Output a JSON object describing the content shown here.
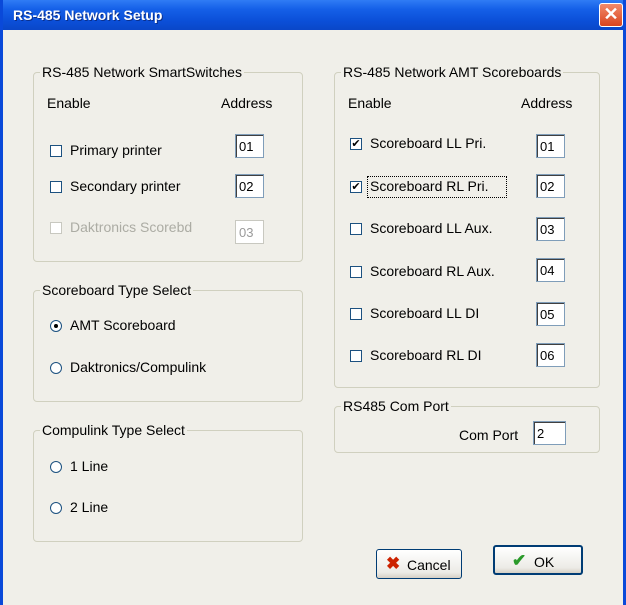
{
  "window": {
    "title": "RS-485 Network Setup",
    "close_glyph": "✕"
  },
  "smartswitches": {
    "legend": "RS-485 Network SmartSwitches",
    "enable_header": "Enable",
    "address_header": "Address",
    "items": [
      {
        "label": "Primary printer",
        "checked": false,
        "enabled": true,
        "address": "01"
      },
      {
        "label": "Secondary printer",
        "checked": false,
        "enabled": true,
        "address": "02"
      },
      {
        "label": "Daktronics Scorebd",
        "checked": false,
        "enabled": false,
        "address": "03"
      }
    ]
  },
  "scoreboard_type": {
    "legend": "Scoreboard Type Select",
    "options": [
      {
        "label": "AMT Scoreboard",
        "selected": true
      },
      {
        "label": "Daktronics/Compulink",
        "selected": false
      }
    ]
  },
  "compulink_type": {
    "legend": "Compulink Type Select",
    "options": [
      {
        "label": "1 Line",
        "selected": false
      },
      {
        "label": "2 Line",
        "selected": false
      }
    ]
  },
  "amt_scoreboards": {
    "legend": "RS-485 Network AMT Scoreboards",
    "enable_header": "Enable",
    "address_header": "Address",
    "items": [
      {
        "label": "Scoreboard LL Pri.",
        "checked": true,
        "address": "01"
      },
      {
        "label": "Scoreboard RL Pri.",
        "checked": true,
        "address": "02",
        "focused": true
      },
      {
        "label": "Scoreboard LL Aux.",
        "checked": false,
        "address": "03"
      },
      {
        "label": "Scoreboard RL Aux.",
        "checked": false,
        "address": "04"
      },
      {
        "label": "Scoreboard LL DI",
        "checked": false,
        "address": "05"
      },
      {
        "label": "Scoreboard RL DI",
        "checked": false,
        "address": "06"
      }
    ]
  },
  "com_port": {
    "legend": "RS485 Com Port",
    "label": "Com Port",
    "value": "2"
  },
  "buttons": {
    "cancel_label": "Cancel",
    "cancel_icon": "cancel-x-icon",
    "ok_label": "OK",
    "ok_icon": "checkmark-icon"
  },
  "colors": {
    "titlebar": "#0a49d9",
    "dialog_bg": "#f0efe9",
    "cancel_icon": "#cc2200",
    "ok_icon": "#2a9a2a"
  }
}
